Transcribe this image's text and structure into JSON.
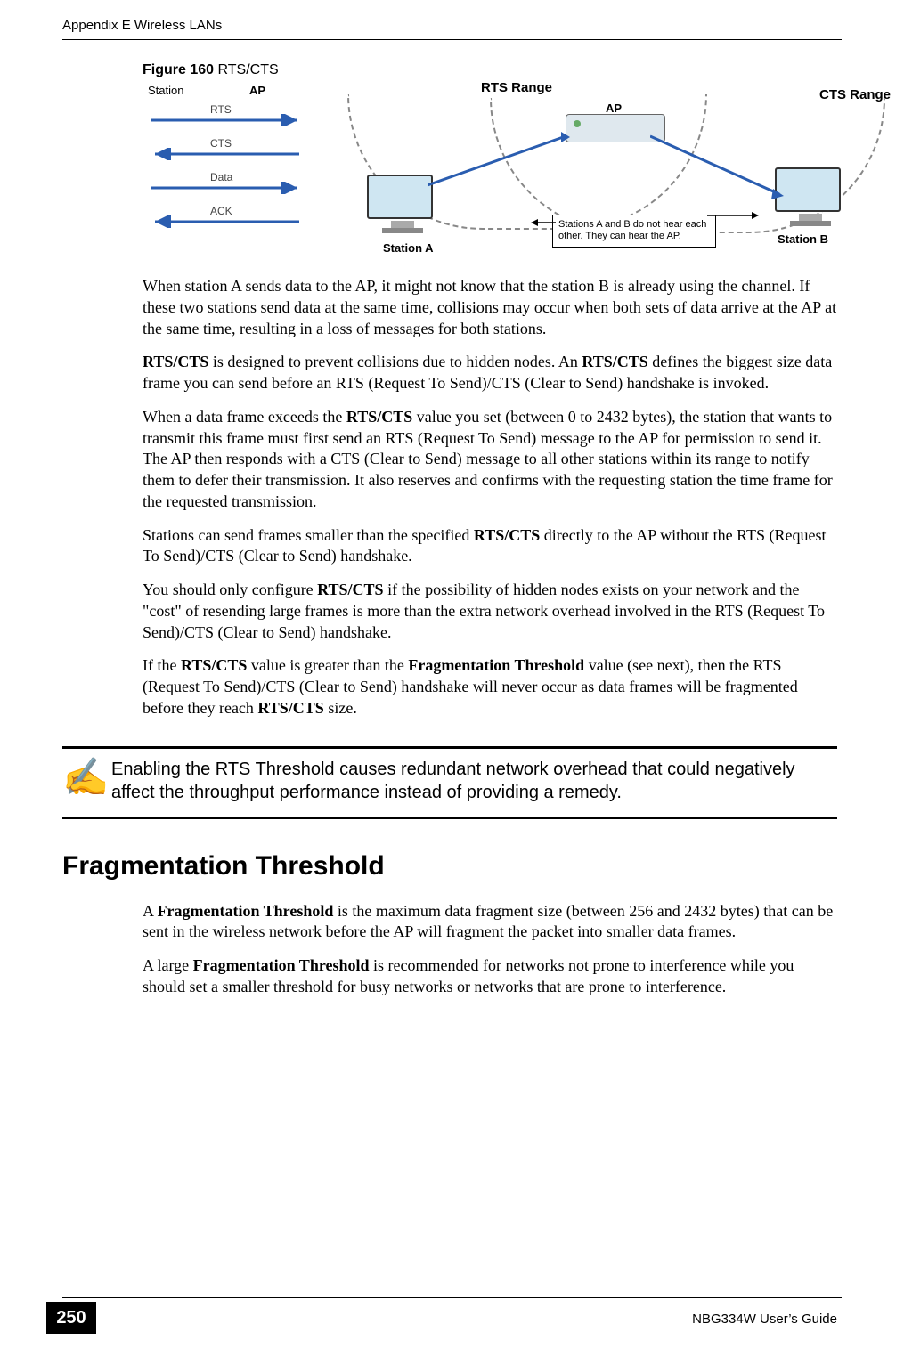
{
  "header": {
    "left": "Appendix E Wireless LANs"
  },
  "figure": {
    "label_bold": "Figure 160",
    "label_rest": "    RTS/CTS",
    "left_labels": {
      "station": "Station",
      "ap": "AP"
    },
    "arrows": [
      {
        "name": "RTS",
        "dir": "right",
        "color": "#2A5DB0"
      },
      {
        "name": "CTS",
        "dir": "left",
        "color": "#2A5DB0"
      },
      {
        "name": "Data",
        "dir": "right",
        "color": "#2A5DB0"
      },
      {
        "name": "ACK",
        "dir": "left",
        "color": "#2A5DB0"
      }
    ],
    "right_labels": {
      "rts_range": "RTS Range",
      "cts_range": "CTS Range",
      "ap": "AP",
      "station_a": "Station  A",
      "station_b": "Station B"
    },
    "callout": "Stations A and B do not hear each other. They can hear the AP."
  },
  "paragraphs": {
    "p1": "When station A sends data to the AP, it might not know that the station B is already using the channel. If these two stations send data at the same time, collisions may occur when both sets of data arrive at the AP at the same time, resulting in a loss of messages for both stations.",
    "p2a": "RTS/CTS",
    "p2b": " is designed to prevent collisions due to hidden nodes. An ",
    "p2c": "RTS/CTS",
    "p2d": " defines the biggest size data frame you can send before an RTS (Request To Send)/CTS (Clear to Send) handshake is invoked.",
    "p3a": "When a data frame exceeds the ",
    "p3b": "RTS/CTS",
    "p3c": " value you set (between 0 to 2432 bytes), the station that wants to transmit this frame must first send an RTS (Request To Send) message to the AP for permission to send it. The AP then responds with a CTS (Clear to Send) message to all other stations within its range to notify them to defer their transmission. It also reserves and confirms with the requesting station the time frame for the requested transmission.",
    "p4a": "Stations can send frames smaller than the specified ",
    "p4b": "RTS/CTS",
    "p4c": " directly to the AP without the RTS (Request To Send)/CTS (Clear to Send) handshake.",
    "p5a": "You should only configure ",
    "p5b": "RTS/CTS",
    "p5c": " if the possibility of hidden nodes exists on your network and the \"cost\" of resending large frames is more than the extra network overhead involved in the RTS (Request To Send)/CTS (Clear to Send) handshake.",
    "p6a": "If the ",
    "p6b": "RTS/CTS",
    "p6c": " value is greater than the ",
    "p6d": "Fragmentation Threshold",
    "p6e": " value (see next), then the RTS (Request To Send)/CTS (Clear to Send) handshake will never occur as data frames will be fragmented before they reach ",
    "p6f": "RTS/CTS",
    "p6g": " size."
  },
  "note": {
    "icon": "✍",
    "text": "Enabling the RTS Threshold causes redundant network overhead that could negatively affect the throughput performance instead of providing a remedy."
  },
  "section": {
    "heading": "Fragmentation Threshold"
  },
  "frag": {
    "p1a": "A ",
    "p1b": "Fragmentation Threshold",
    "p1c": " is the maximum data fragment size (between 256 and 2432 bytes) that can be sent in the wireless network before the AP will fragment the packet into smaller data frames.",
    "p2a": "A large ",
    "p2b": "Fragmentation Threshold",
    "p2c": " is recommended for networks not prone to interference while you should set a smaller threshold for busy networks or networks that are prone to interference."
  },
  "footer": {
    "page": "250",
    "right": "NBG334W User’s Guide"
  }
}
